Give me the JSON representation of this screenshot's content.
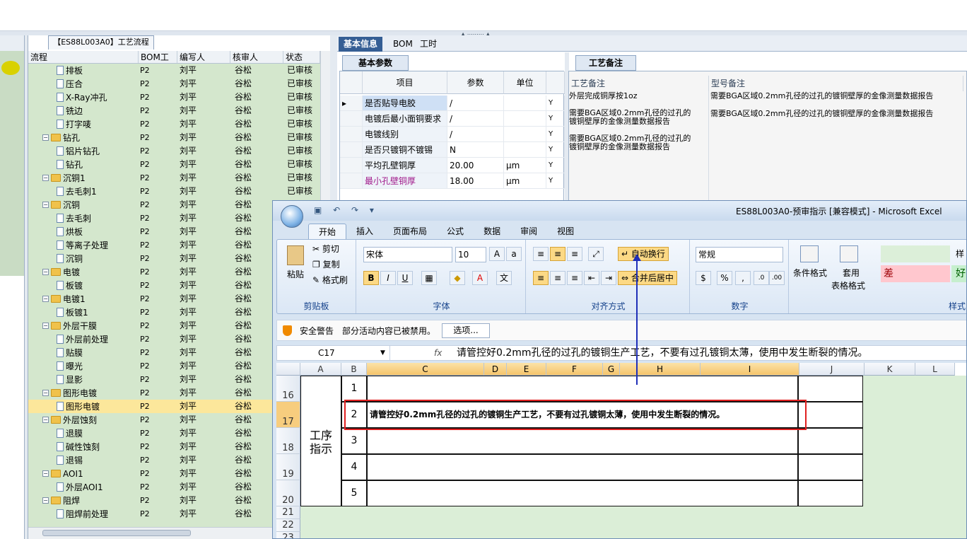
{
  "process_panel": {
    "tab_label": "【ES88L003A0】工艺流程",
    "columns": [
      "流程",
      "BOM工厂",
      "编写人",
      "核审人",
      "状态"
    ],
    "rows": [
      {
        "name": "排板",
        "kind": "doc",
        "level": 2,
        "bom": "P2",
        "writer": "刘平",
        "checker": "谷松",
        "status": "已审核"
      },
      {
        "name": "压合",
        "kind": "doc",
        "level": 2,
        "bom": "P2",
        "writer": "刘平",
        "checker": "谷松",
        "status": "已审核"
      },
      {
        "name": "X-Ray冲孔",
        "kind": "doc",
        "level": 2,
        "bom": "P2",
        "writer": "刘平",
        "checker": "谷松",
        "status": "已审核"
      },
      {
        "name": "铣边",
        "kind": "doc",
        "level": 2,
        "bom": "P2",
        "writer": "刘平",
        "checker": "谷松",
        "status": "已审核"
      },
      {
        "name": "打字唛",
        "kind": "doc",
        "level": 2,
        "bom": "P2",
        "writer": "刘平",
        "checker": "谷松",
        "status": "已审核"
      },
      {
        "name": "钻孔",
        "kind": "folder",
        "level": 1,
        "bom": "P2",
        "writer": "刘平",
        "checker": "谷松",
        "status": "已审核"
      },
      {
        "name": "铝片钻孔",
        "kind": "doc",
        "level": 2,
        "bom": "P2",
        "writer": "刘平",
        "checker": "谷松",
        "status": "已审核"
      },
      {
        "name": "钻孔",
        "kind": "doc",
        "level": 2,
        "bom": "P2",
        "writer": "刘平",
        "checker": "谷松",
        "status": "已审核"
      },
      {
        "name": "沉铜1",
        "kind": "folder",
        "level": 1,
        "bom": "P2",
        "writer": "刘平",
        "checker": "谷松",
        "status": "已审核"
      },
      {
        "name": "去毛刺1",
        "kind": "doc",
        "level": 2,
        "bom": "P2",
        "writer": "刘平",
        "checker": "谷松",
        "status": "已审核"
      },
      {
        "name": "沉铜",
        "kind": "folder",
        "level": 1,
        "bom": "P2",
        "writer": "刘平",
        "checker": "谷松",
        "status": ""
      },
      {
        "name": "去毛刺",
        "kind": "doc",
        "level": 2,
        "bom": "P2",
        "writer": "刘平",
        "checker": "谷松",
        "status": ""
      },
      {
        "name": "烘板",
        "kind": "doc",
        "level": 2,
        "bom": "P2",
        "writer": "刘平",
        "checker": "谷松",
        "status": ""
      },
      {
        "name": "等离子处理",
        "kind": "doc",
        "level": 2,
        "bom": "P2",
        "writer": "刘平",
        "checker": "谷松",
        "status": ""
      },
      {
        "name": "沉铜",
        "kind": "doc",
        "level": 2,
        "bom": "P2",
        "writer": "刘平",
        "checker": "谷松",
        "status": ""
      },
      {
        "name": "电镀",
        "kind": "folder",
        "level": 1,
        "bom": "P2",
        "writer": "刘平",
        "checker": "谷松",
        "status": ""
      },
      {
        "name": "板镀",
        "kind": "doc",
        "level": 2,
        "bom": "P2",
        "writer": "刘平",
        "checker": "谷松",
        "status": ""
      },
      {
        "name": "电镀1",
        "kind": "folder",
        "level": 1,
        "bom": "P2",
        "writer": "刘平",
        "checker": "谷松",
        "status": ""
      },
      {
        "name": "板镀1",
        "kind": "doc",
        "level": 2,
        "bom": "P2",
        "writer": "刘平",
        "checker": "谷松",
        "status": ""
      },
      {
        "name": "外层干膜",
        "kind": "folder",
        "level": 1,
        "bom": "P2",
        "writer": "刘平",
        "checker": "谷松",
        "status": ""
      },
      {
        "name": "外层前处理",
        "kind": "doc",
        "level": 2,
        "bom": "P2",
        "writer": "刘平",
        "checker": "谷松",
        "status": ""
      },
      {
        "name": "贴膜",
        "kind": "doc",
        "level": 2,
        "bom": "P2",
        "writer": "刘平",
        "checker": "谷松",
        "status": ""
      },
      {
        "name": "曝光",
        "kind": "doc",
        "level": 2,
        "bom": "P2",
        "writer": "刘平",
        "checker": "谷松",
        "status": ""
      },
      {
        "name": "显影",
        "kind": "doc",
        "level": 2,
        "bom": "P2",
        "writer": "刘平",
        "checker": "谷松",
        "status": ""
      },
      {
        "name": "图形电镀",
        "kind": "folder",
        "level": 1,
        "bom": "P2",
        "writer": "刘平",
        "checker": "谷松",
        "status": ""
      },
      {
        "name": "图形电镀",
        "kind": "doc",
        "level": 2,
        "bom": "P2",
        "writer": "刘平",
        "checker": "谷松",
        "status": "",
        "selected": true
      },
      {
        "name": "外层蚀刻",
        "kind": "folder",
        "level": 1,
        "bom": "P2",
        "writer": "刘平",
        "checker": "谷松",
        "status": ""
      },
      {
        "name": "退膜",
        "kind": "doc",
        "level": 2,
        "bom": "P2",
        "writer": "刘平",
        "checker": "谷松",
        "status": ""
      },
      {
        "name": "碱性蚀刻",
        "kind": "doc",
        "level": 2,
        "bom": "P2",
        "writer": "刘平",
        "checker": "谷松",
        "status": ""
      },
      {
        "name": "退锡",
        "kind": "doc",
        "level": 2,
        "bom": "P2",
        "writer": "刘平",
        "checker": "谷松",
        "status": ""
      },
      {
        "name": "AOI1",
        "kind": "folder",
        "level": 1,
        "bom": "P2",
        "writer": "刘平",
        "checker": "谷松",
        "status": ""
      },
      {
        "name": "外层AOI1",
        "kind": "doc",
        "level": 2,
        "bom": "P2",
        "writer": "刘平",
        "checker": "谷松",
        "status": ""
      },
      {
        "name": "阻焊",
        "kind": "folder",
        "level": 1,
        "bom": "P2",
        "writer": "刘平",
        "checker": "谷松",
        "status": ""
      },
      {
        "name": "阻焊前处理",
        "kind": "doc",
        "level": 2,
        "bom": "P2",
        "writer": "刘平",
        "checker": "谷松",
        "status": ""
      }
    ]
  },
  "detail_tabs": [
    "基本信息",
    "BOM",
    "工时"
  ],
  "basic_params": {
    "tab_label": "基本参数",
    "columns": [
      "项目",
      "参数",
      "单位"
    ],
    "rows": [
      {
        "item": "是否贴导电胶",
        "value": "/",
        "unit": "",
        "flag": "Y",
        "current": true
      },
      {
        "item": "电镀后最小面铜要求",
        "value": "/",
        "unit": "",
        "flag": "Y"
      },
      {
        "item": "电镀线别",
        "value": "/",
        "unit": "",
        "flag": "Y"
      },
      {
        "item": "是否只镀铜不镀锡",
        "value": "N",
        "unit": "",
        "flag": "Y"
      },
      {
        "item": "平均孔壁铜厚",
        "value": "20.00",
        "unit": "μm",
        "flag": "Y"
      },
      {
        "item": "最小孔壁铜厚",
        "value": "18.00",
        "unit": "μm",
        "flag": "Y",
        "highlight": true
      }
    ]
  },
  "process_notes": {
    "tab_label": "工艺备注",
    "columns": [
      "工艺备注",
      "型号备注"
    ],
    "notes_left": [
      "外层完成铜厚按1oz",
      "需要BGA区域0.2mm孔径的过孔的镀铜壁厚的金像测量数据报告",
      "需要BGA区域0.2mm孔径的过孔的镀铜壁厚的金像测量数据报告"
    ],
    "notes_right": [
      "需要BGA区域0.2mm孔径的过孔的镀铜壁厚的金像测量数据报告",
      "需要BGA区域0.2mm孔径的过孔的镀铜壁厚的金像测量数据报告"
    ]
  },
  "excel": {
    "title": "ES88L003A0-预审指示 [兼容模式] - Microsoft Excel",
    "ribbon_tabs": [
      "开始",
      "插入",
      "页面布局",
      "公式",
      "数据",
      "审阅",
      "视图"
    ],
    "clipboard": {
      "paste": "粘贴",
      "cut": "剪切",
      "copy": "复制",
      "format_painter": "格式刷",
      "label": "剪贴板"
    },
    "font": {
      "name": "宋体",
      "size": "10",
      "label": "字体"
    },
    "alignment": {
      "wrap": "自动换行",
      "merge": "合并后居中",
      "label": "对齐方式"
    },
    "number": {
      "format": "常规",
      "label": "数字"
    },
    "styles": {
      "conditional": "条件格式",
      "table_format_1": "套用",
      "table_format_2": "表格格式",
      "bad": "差",
      "good": "好",
      "neutral": "样",
      "label": "样式"
    },
    "security": {
      "title": "安全警告",
      "message": "部分活动内容已被禁用。",
      "options": "选项..."
    },
    "name_box": "C17",
    "formula": "请管控好0.2mm孔径的过孔的镀铜生产工艺，不要有过孔镀铜太薄，使用中发生断裂的情况。",
    "columns": [
      "A",
      "B",
      "C",
      "D",
      "E",
      "F",
      "G",
      "H",
      "I",
      "J",
      "K",
      "L"
    ],
    "rows": [
      "16",
      "17",
      "18",
      "19",
      "20",
      "21",
      "22",
      "23"
    ],
    "section_label": "工序指示",
    "numbers": [
      "1",
      "2",
      "3",
      "4",
      "5"
    ],
    "cell_c17": "请管控好0.2mm孔径的过孔的镀铜生产工艺，不要有过孔镀铜太薄，使用中发生断裂的情况。"
  }
}
